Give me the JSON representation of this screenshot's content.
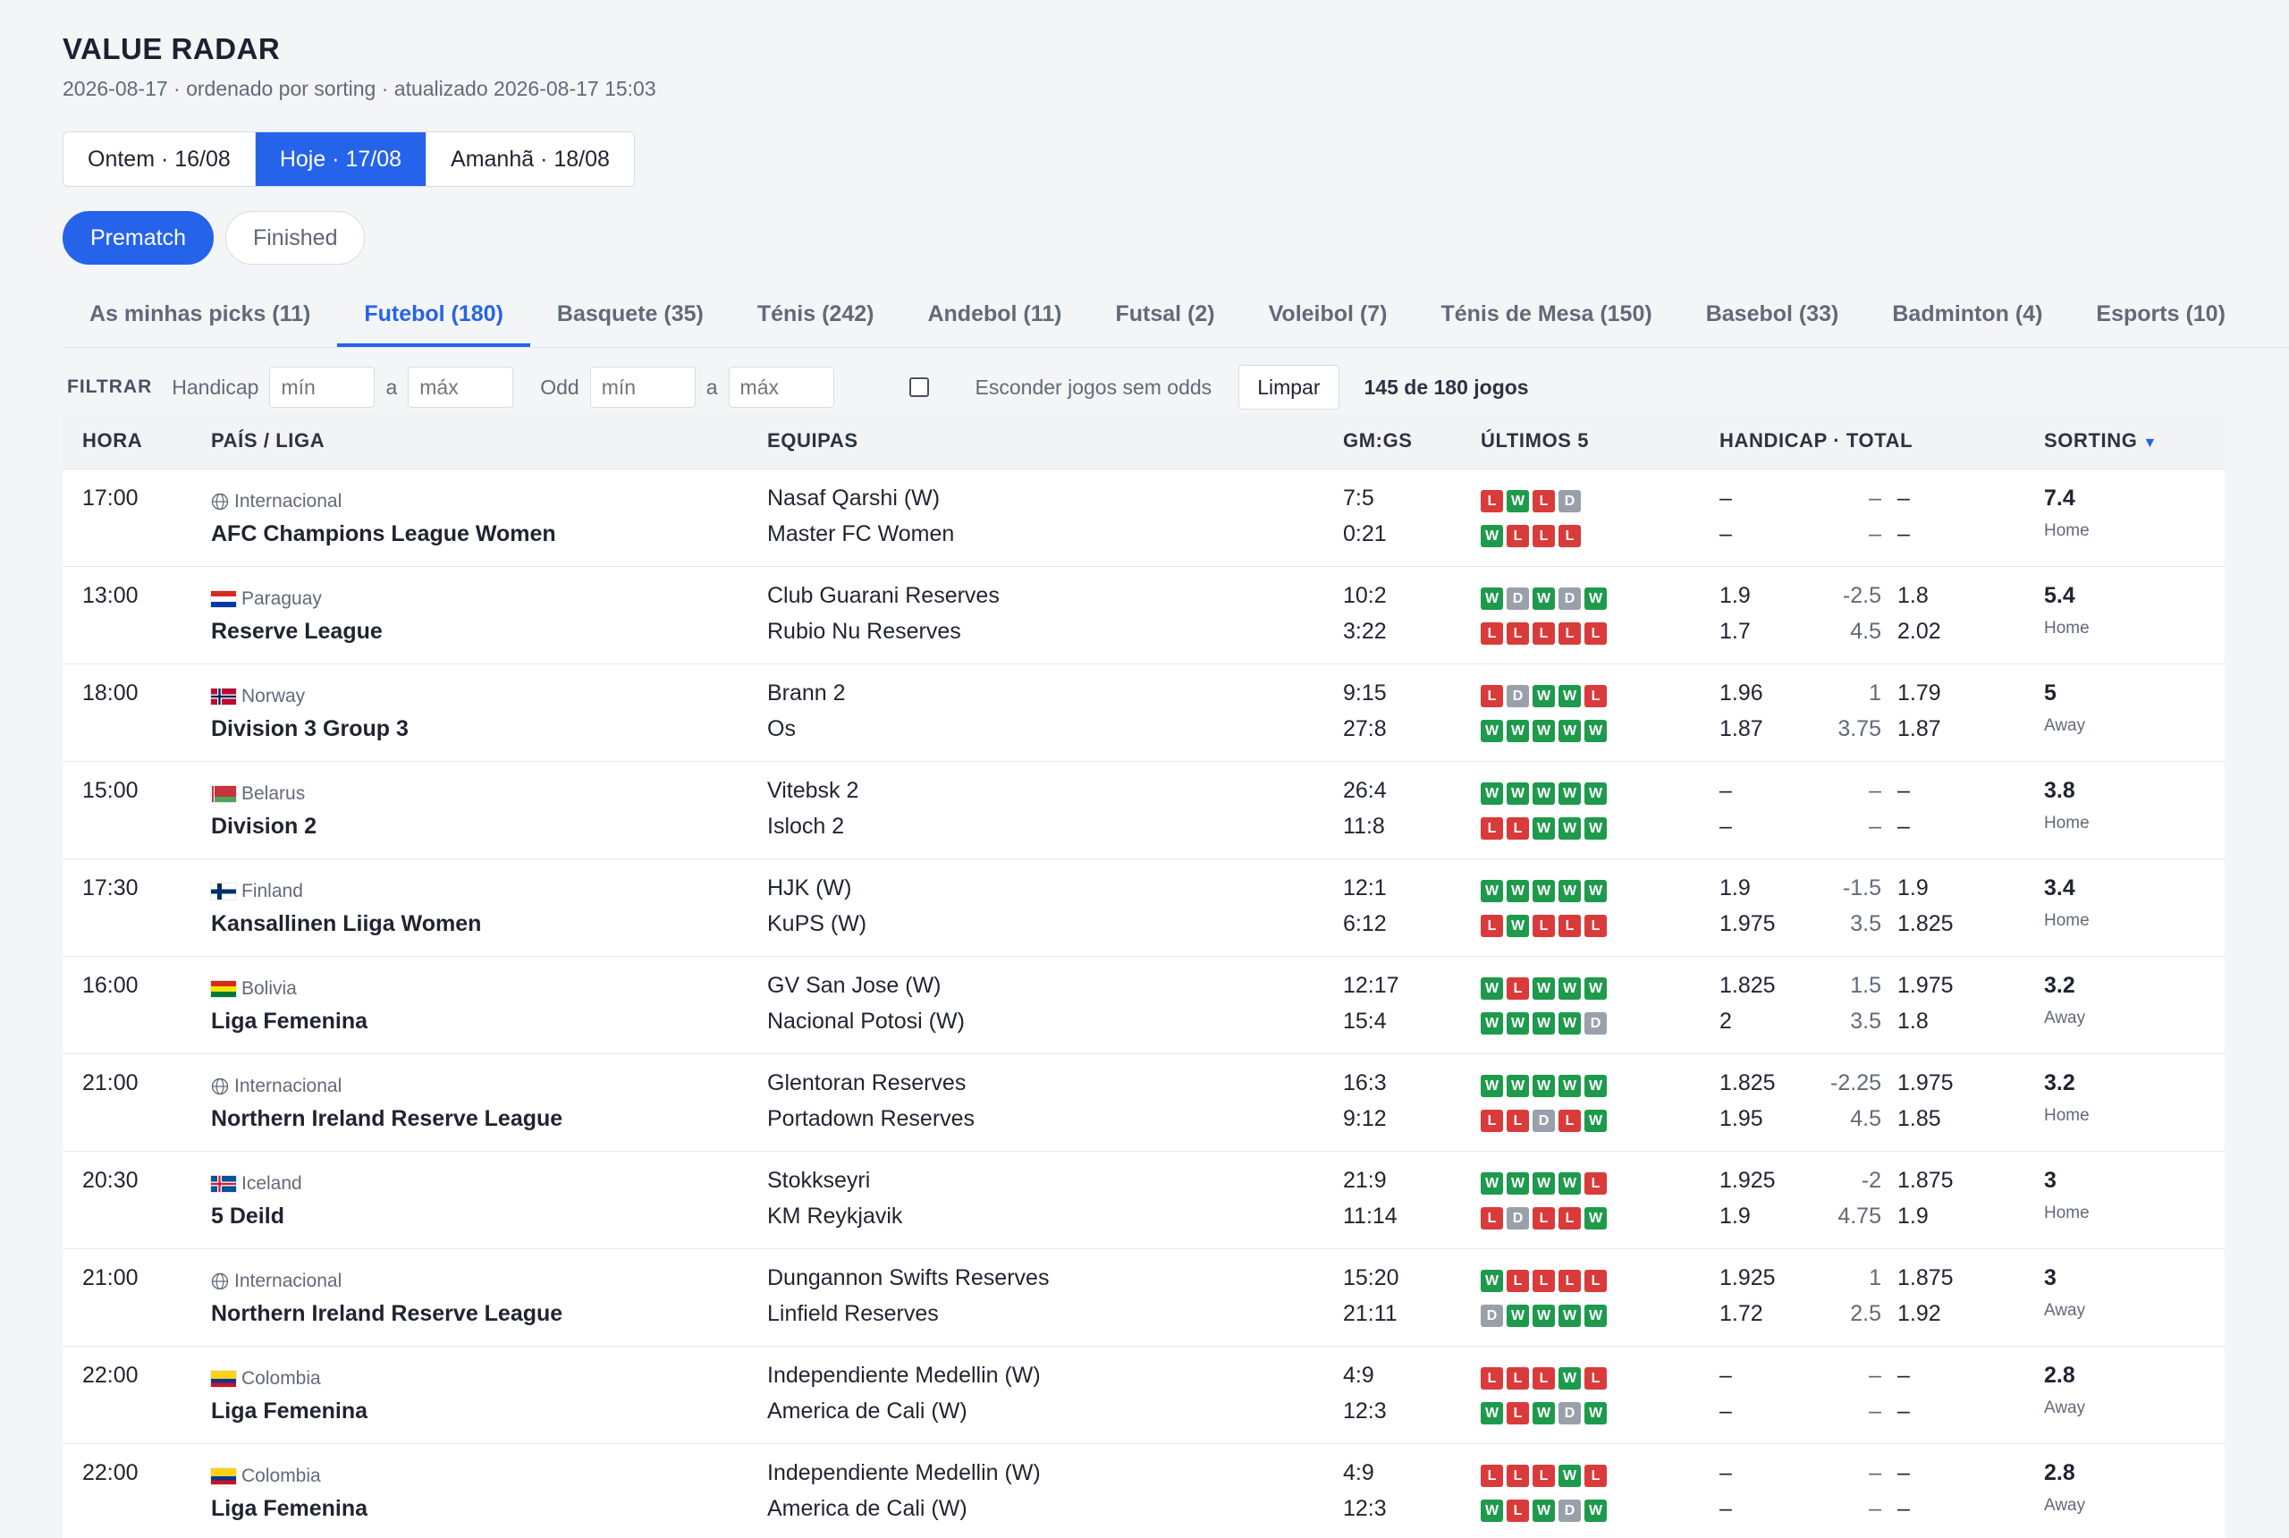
{
  "header": {
    "title": "VALUE RADAR",
    "subtitle": "2026-08-17 · ordenado por sorting · atualizado 2026-08-17 15:03"
  },
  "day_tabs": [
    {
      "label": "Ontem · 16/08",
      "active": false
    },
    {
      "label": "Hoje · 17/08",
      "active": true
    },
    {
      "label": "Amanhã · 18/08",
      "active": false
    }
  ],
  "modes": [
    {
      "label": "Prematch",
      "active": true
    },
    {
      "label": "Finished",
      "active": false
    }
  ],
  "sport_tabs": [
    {
      "label": "As minhas picks (11)",
      "active": false
    },
    {
      "label": "Futebol (180)",
      "active": true
    },
    {
      "label": "Basquete (35)",
      "active": false
    },
    {
      "label": "Ténis (242)",
      "active": false
    },
    {
      "label": "Andebol (11)",
      "active": false
    },
    {
      "label": "Futsal (2)",
      "active": false
    },
    {
      "label": "Voleibol (7)",
      "active": false
    },
    {
      "label": "Ténis de Mesa (150)",
      "active": false
    },
    {
      "label": "Basebol (33)",
      "active": false
    },
    {
      "label": "Badminton (4)",
      "active": false
    },
    {
      "label": "Esports (10)",
      "active": false
    }
  ],
  "filters": {
    "label": "FILTRAR",
    "handicap_label": "Handicap",
    "odd_label": "Odd",
    "min_placeholder": "mín",
    "max_placeholder": "máx",
    "range_sep": "a",
    "hide_no_odds_label": "Esconder jogos sem odds",
    "hide_no_odds_checked": false,
    "clear_label": "Limpar",
    "count": "145 de 180 jogos"
  },
  "table": {
    "columns": {
      "time": "HORA",
      "league": "PAÍS / LIGA",
      "teams": "EQUIPAS",
      "goals": "GM:GS",
      "form": "ÚLTIMOS 5",
      "odds": "HANDICAP · TOTAL",
      "sorting": "SORTING"
    },
    "sort_arrow": "▼",
    "rows": [
      {
        "time": "17:00",
        "country": "Internacional",
        "flag": "globe",
        "league": "AFC Champions League Women",
        "home": "Nasaf Qarshi (W)",
        "away": "Master FC Women",
        "gs_home": "7:5",
        "gs_away": "0:21",
        "form_home": [
          "L",
          "W",
          "L",
          "D"
        ],
        "form_away": [
          "W",
          "L",
          "L",
          "L"
        ],
        "h1": "–",
        "hl1": "–",
        "t1": "–",
        "h2": "–",
        "hl2": "–",
        "t2": "–",
        "score": "7.4",
        "side": "Home"
      },
      {
        "time": "13:00",
        "country": "Paraguay",
        "flag": "paraguay",
        "league": "Reserve League",
        "home": "Club Guarani Reserves",
        "away": "Rubio Nu Reserves",
        "gs_home": "10:2",
        "gs_away": "3:22",
        "form_home": [
          "W",
          "D",
          "W",
          "D",
          "W"
        ],
        "form_away": [
          "L",
          "L",
          "L",
          "L",
          "L"
        ],
        "h1": "1.9",
        "hl1": "-2.5",
        "t1": "1.8",
        "h2": "1.7",
        "hl2": "4.5",
        "t2": "2.02",
        "score": "5.4",
        "side": "Home"
      },
      {
        "time": "18:00",
        "country": "Norway",
        "flag": "norway",
        "league": "Division 3 Group 3",
        "home": "Brann 2",
        "away": "Os",
        "gs_home": "9:15",
        "gs_away": "27:8",
        "form_home": [
          "L",
          "D",
          "W",
          "W",
          "L"
        ],
        "form_away": [
          "W",
          "W",
          "W",
          "W",
          "W"
        ],
        "h1": "1.96",
        "hl1": "1",
        "t1": "1.79",
        "h2": "1.87",
        "hl2": "3.75",
        "t2": "1.87",
        "score": "5",
        "side": "Away"
      },
      {
        "time": "15:00",
        "country": "Belarus",
        "flag": "belarus",
        "league": "Division 2",
        "home": "Vitebsk 2",
        "away": "Isloch 2",
        "gs_home": "26:4",
        "gs_away": "11:8",
        "form_home": [
          "W",
          "W",
          "W",
          "W",
          "W"
        ],
        "form_away": [
          "L",
          "L",
          "W",
          "W",
          "W"
        ],
        "h1": "–",
        "hl1": "–",
        "t1": "–",
        "h2": "–",
        "hl2": "–",
        "t2": "–",
        "score": "3.8",
        "side": "Home"
      },
      {
        "time": "17:30",
        "country": "Finland",
        "flag": "finland",
        "league": "Kansallinen Liiga Women",
        "home": "HJK (W)",
        "away": "KuPS (W)",
        "gs_home": "12:1",
        "gs_away": "6:12",
        "form_home": [
          "W",
          "W",
          "W",
          "W",
          "W"
        ],
        "form_away": [
          "L",
          "W",
          "L",
          "L",
          "L"
        ],
        "h1": "1.9",
        "hl1": "-1.5",
        "t1": "1.9",
        "h2": "1.975",
        "hl2": "3.5",
        "t2": "1.825",
        "score": "3.4",
        "side": "Home"
      },
      {
        "time": "16:00",
        "country": "Bolivia",
        "flag": "bolivia",
        "league": "Liga Femenina",
        "home": "GV San Jose (W)",
        "away": "Nacional Potosi (W)",
        "gs_home": "12:17",
        "gs_away": "15:4",
        "form_home": [
          "W",
          "L",
          "W",
          "W",
          "W"
        ],
        "form_away": [
          "W",
          "W",
          "W",
          "W",
          "D"
        ],
        "h1": "1.825",
        "hl1": "1.5",
        "t1": "1.975",
        "h2": "2",
        "hl2": "3.5",
        "t2": "1.8",
        "score": "3.2",
        "side": "Away"
      },
      {
        "time": "21:00",
        "country": "Internacional",
        "flag": "globe",
        "league": "Northern Ireland Reserve League",
        "home": "Glentoran Reserves",
        "away": "Portadown Reserves",
        "gs_home": "16:3",
        "gs_away": "9:12",
        "form_home": [
          "W",
          "W",
          "W",
          "W",
          "W"
        ],
        "form_away": [
          "L",
          "L",
          "D",
          "L",
          "W"
        ],
        "h1": "1.825",
        "hl1": "-2.25",
        "t1": "1.975",
        "h2": "1.95",
        "hl2": "4.5",
        "t2": "1.85",
        "score": "3.2",
        "side": "Home"
      },
      {
        "time": "20:30",
        "country": "Iceland",
        "flag": "iceland",
        "league": "5 Deild",
        "home": "Stokkseyri",
        "away": "KM Reykjavik",
        "gs_home": "21:9",
        "gs_away": "11:14",
        "form_home": [
          "W",
          "W",
          "W",
          "W",
          "L"
        ],
        "form_away": [
          "L",
          "D",
          "L",
          "L",
          "W"
        ],
        "h1": "1.925",
        "hl1": "-2",
        "t1": "1.875",
        "h2": "1.9",
        "hl2": "4.75",
        "t2": "1.9",
        "score": "3",
        "side": "Home"
      },
      {
        "time": "21:00",
        "country": "Internacional",
        "flag": "globe",
        "league": "Northern Ireland Reserve League",
        "home": "Dungannon Swifts Reserves",
        "away": "Linfield Reserves",
        "gs_home": "15:20",
        "gs_away": "21:11",
        "form_home": [
          "W",
          "L",
          "L",
          "L",
          "L"
        ],
        "form_away": [
          "D",
          "W",
          "W",
          "W",
          "W"
        ],
        "h1": "1.925",
        "hl1": "1",
        "t1": "1.875",
        "h2": "1.72",
        "hl2": "2.5",
        "t2": "1.92",
        "score": "3",
        "side": "Away"
      },
      {
        "time": "22:00",
        "country": "Colombia",
        "flag": "colombia",
        "league": "Liga Femenina",
        "home": "Independiente Medellin (W)",
        "away": "America de Cali (W)",
        "gs_home": "4:9",
        "gs_away": "12:3",
        "form_home": [
          "L",
          "L",
          "L",
          "W",
          "L"
        ],
        "form_away": [
          "W",
          "L",
          "W",
          "D",
          "W"
        ],
        "h1": "–",
        "hl1": "–",
        "t1": "–",
        "h2": "–",
        "hl2": "–",
        "t2": "–",
        "score": "2.8",
        "side": "Away"
      },
      {
        "time": "22:00",
        "country": "Colombia",
        "flag": "colombia",
        "league": "Liga Femenina",
        "home": "Independiente Medellin (W)",
        "away": "America de Cali (W)",
        "gs_home": "4:9",
        "gs_away": "12:3",
        "form_home": [
          "L",
          "L",
          "L",
          "W",
          "L"
        ],
        "form_away": [
          "W",
          "L",
          "W",
          "D",
          "W"
        ],
        "h1": "–",
        "hl1": "–",
        "t1": "–",
        "h2": "–",
        "hl2": "–",
        "t2": "–",
        "score": "2.8",
        "side": "Away"
      }
    ]
  },
  "colors": {
    "accent": "#2563eb",
    "win": "#1e9a4c",
    "loss": "#d93b3b",
    "draw": "#9aa0aa"
  }
}
